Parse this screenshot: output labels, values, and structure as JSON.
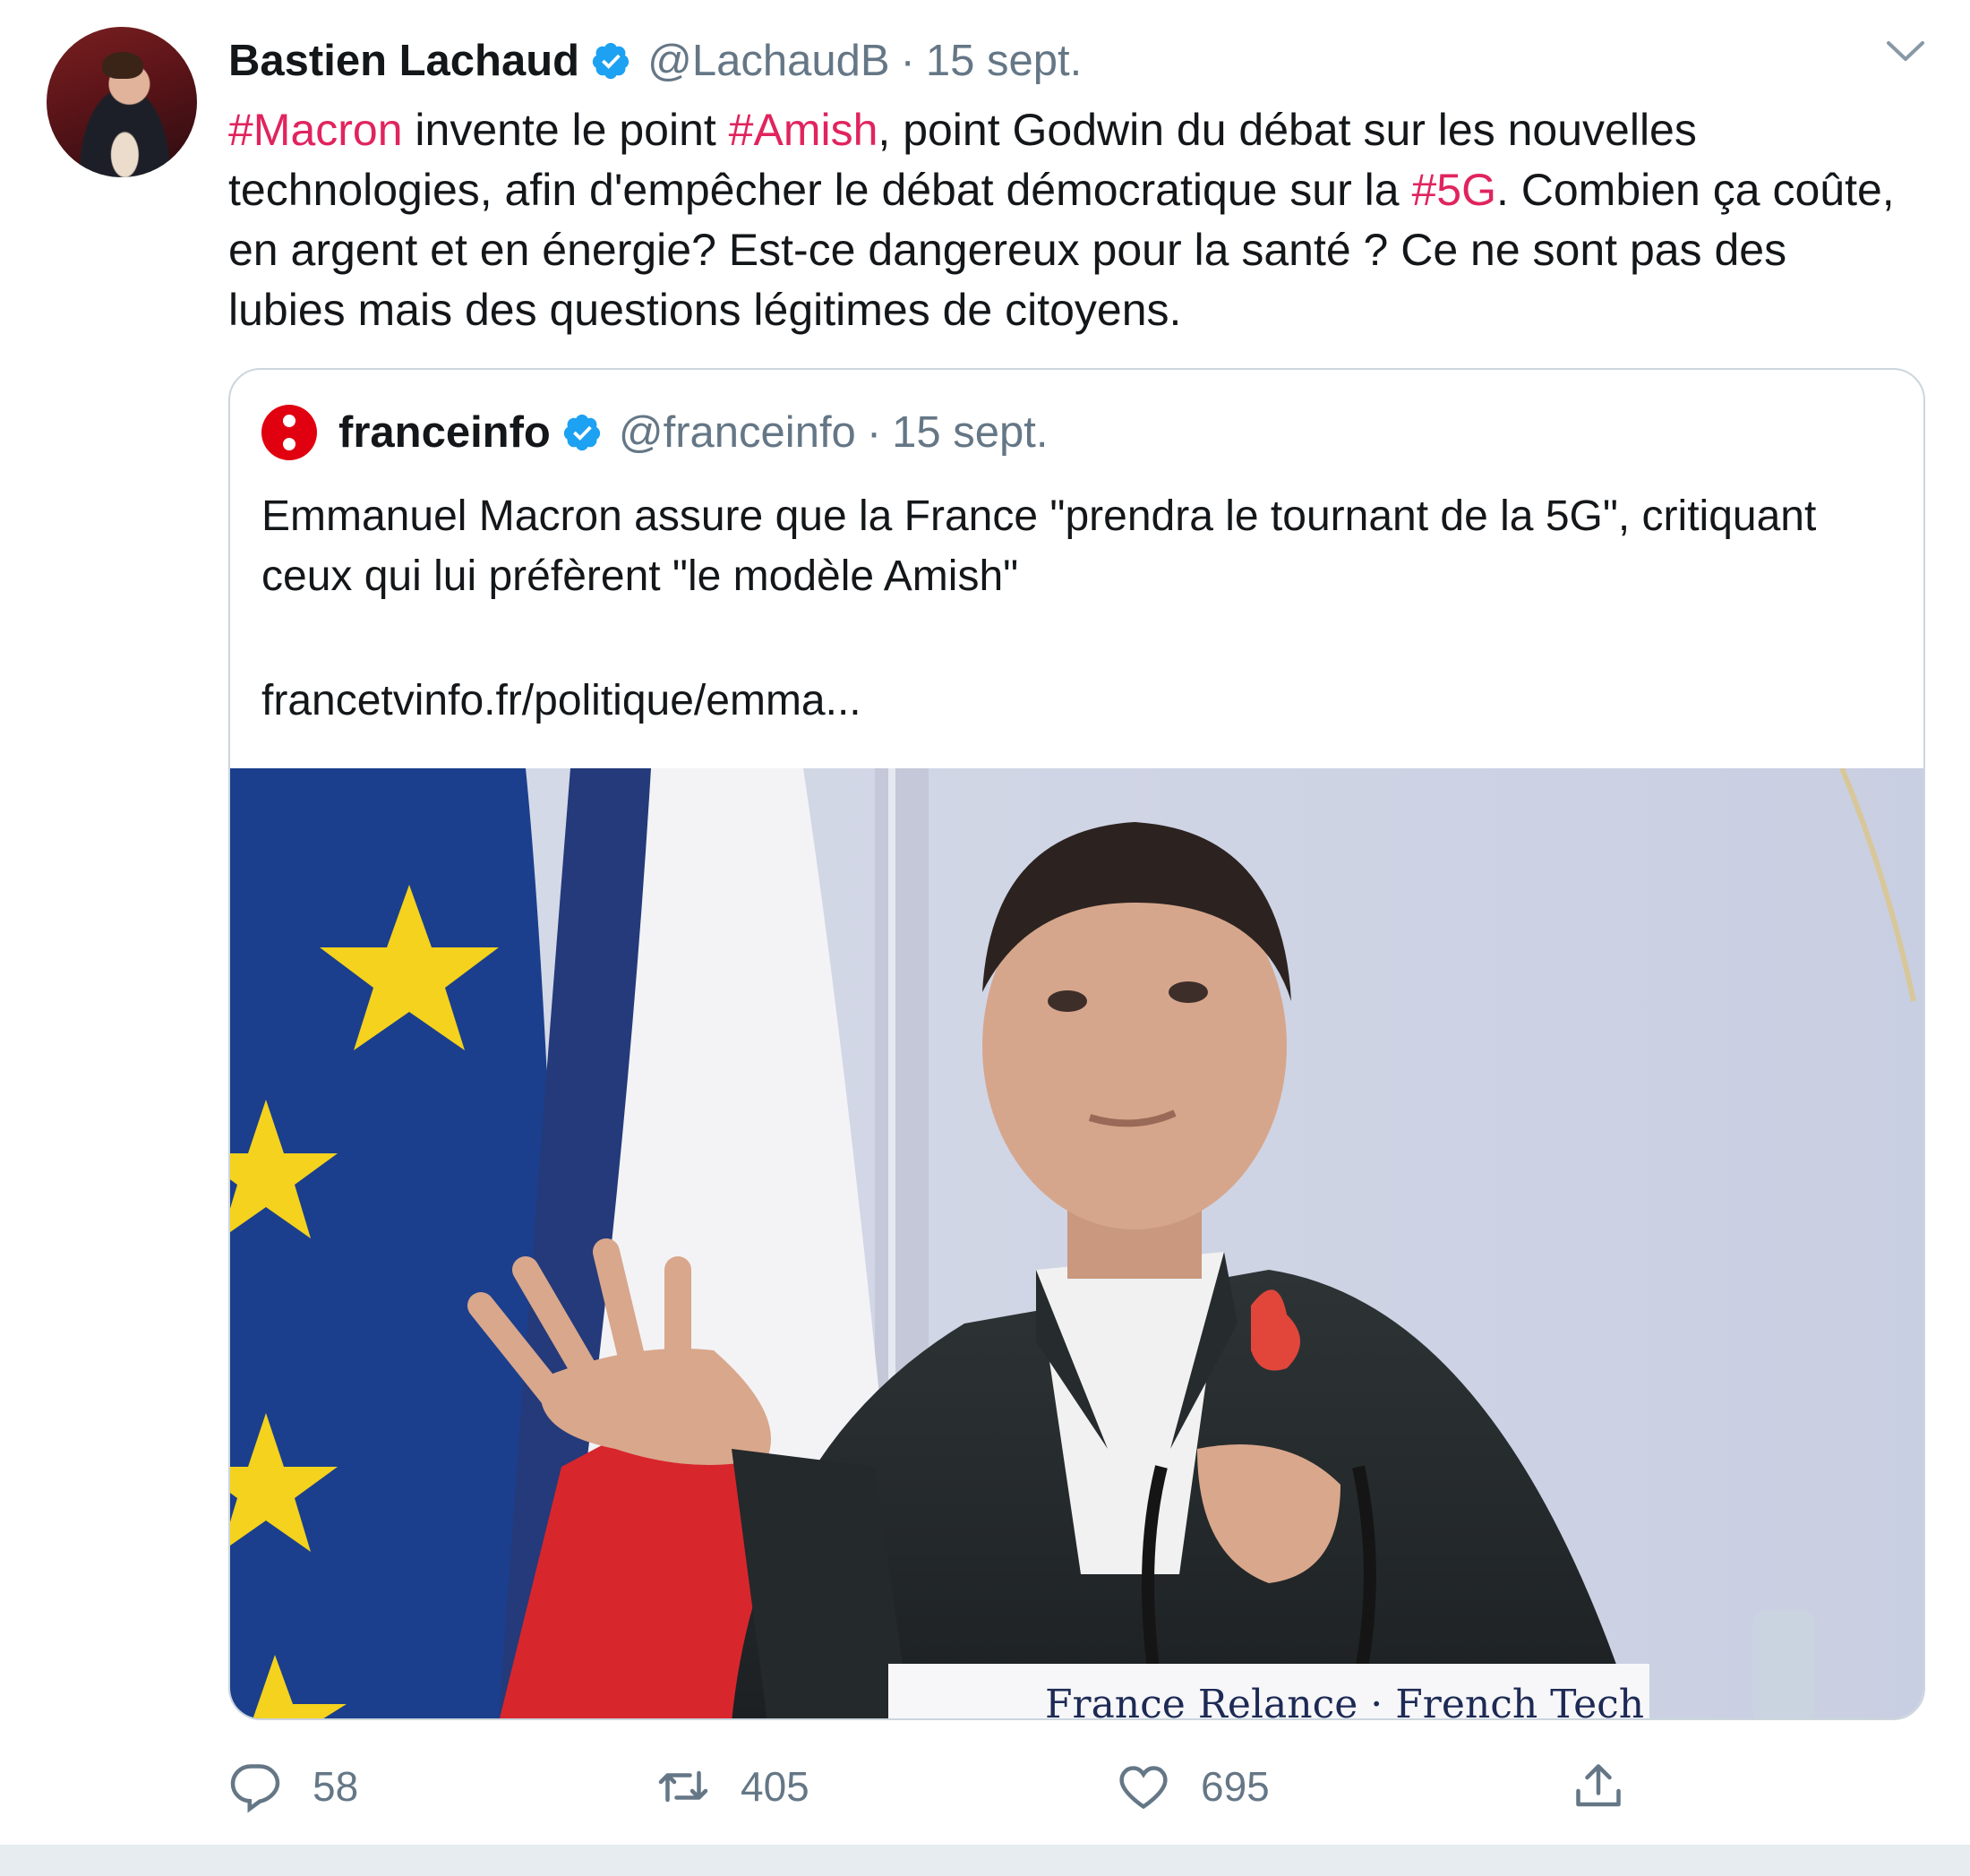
{
  "tweet": {
    "author": {
      "display_name": "Bastien Lachaud",
      "handle": "@LachaudB",
      "date": "15 sept."
    },
    "text_segments": [
      {
        "text": "#Macron",
        "hashtag": true
      },
      {
        "text": " invente le point ",
        "hashtag": false
      },
      {
        "text": "#Amish",
        "hashtag": true
      },
      {
        "text": ", point Godwin du débat sur les nouvelles technologies, afin d'empêcher le débat démocratique sur la ",
        "hashtag": false
      },
      {
        "text": "#5G",
        "hashtag": true
      },
      {
        "text": ". Combien ça coûte, en argent et en énergie? Est-ce dangereux pour la santé ? Ce ne sont pas des lubies mais des questions légitimes de citoyens.",
        "hashtag": false
      }
    ],
    "quoted": {
      "display_name": "franceinfo",
      "handle": "@franceinfo",
      "date": "15 sept.",
      "text": "Emmanuel Macron assure que la France \"prendra le tournant de la 5G\", critiquant ceux qui lui préfèrent \"le modèle Amish\"",
      "link": "francetvinfo.fr/politique/emma...",
      "podium_sign": "France Relance · French Tech"
    },
    "stats": {
      "replies": "58",
      "retweets": "405",
      "likes": "695"
    }
  },
  "colors": {
    "hashtag": "#e0245e",
    "verified": "#1da1f2",
    "muted": "#657786",
    "border": "#ccd6dd",
    "franceinfo_logo": "#e1000f"
  },
  "icons": [
    "verified-badge-icon",
    "chevron-down-icon",
    "franceinfo-logo-icon",
    "reply-icon",
    "retweet-icon",
    "like-icon",
    "share-icon"
  ]
}
